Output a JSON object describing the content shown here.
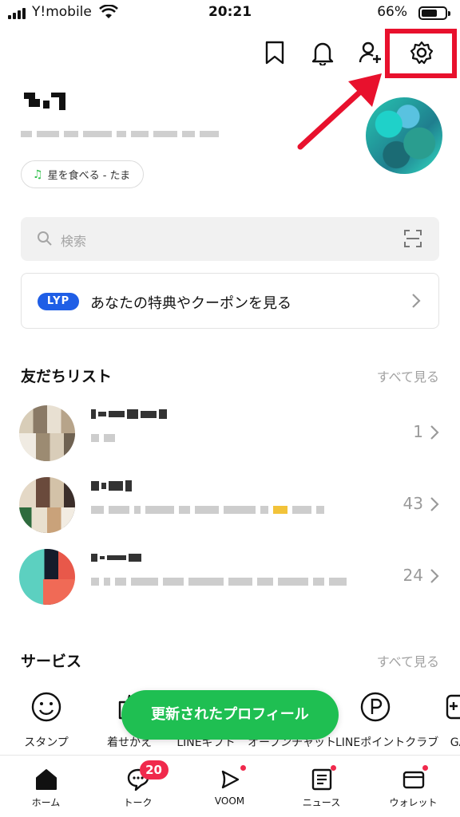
{
  "status_bar": {
    "carrier": "Y!mobile",
    "time": "20:21",
    "battery": "66%",
    "battery_level": 0.66
  },
  "profile": {
    "music": "星を食べる - たま"
  },
  "search": {
    "placeholder": "検索"
  },
  "banner": {
    "logo": "LYP",
    "text": "あなたの特典やクーポンを見る"
  },
  "friends": {
    "title": "友だちリスト",
    "see_all": "すべて見る",
    "items": [
      {
        "count": "1"
      },
      {
        "count": "43"
      },
      {
        "count": "24"
      }
    ]
  },
  "services": {
    "title": "サービス",
    "see_all": "すべて見る",
    "items": [
      {
        "label": "スタンプ",
        "icon": "smile-icon"
      },
      {
        "label": "着せかえ",
        "icon": "theme-icon"
      },
      {
        "label": "LINEギフト",
        "icon": "gift-icon"
      },
      {
        "label": "オープンチャット",
        "icon": "chat-icon"
      },
      {
        "label": "LINEポイントクラブ",
        "icon": "points-icon"
      },
      {
        "label": "GA",
        "icon": "game-icon"
      }
    ]
  },
  "toast": {
    "label": "更新されたプロフィール"
  },
  "tabs": [
    {
      "label": "ホーム",
      "icon": "home-icon"
    },
    {
      "label": "トーク",
      "icon": "chat-icon",
      "badge": "20"
    },
    {
      "label": "VOOM",
      "icon": "voom-icon"
    },
    {
      "label": "ニュース",
      "icon": "news-icon"
    },
    {
      "label": "ウォレット",
      "icon": "wallet-icon"
    }
  ],
  "colors": {
    "accent_green": "#1fbf52",
    "highlight_red": "#e8112d",
    "badge_red": "#f0294c",
    "lyp_blue": "#1f5ee6"
  }
}
